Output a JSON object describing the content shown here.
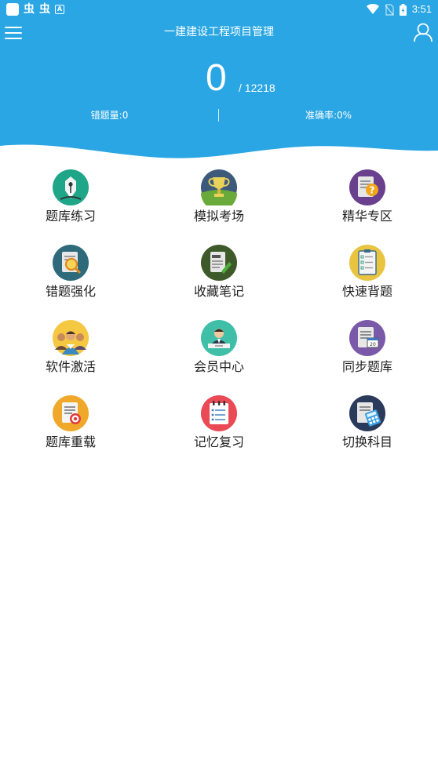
{
  "status_bar": {
    "left_glyph_1": "虫",
    "left_glyph_2": "虫",
    "left_badge": "A",
    "time": "3:51",
    "icons": [
      "wifi-icon",
      "no-sim-icon",
      "battery-charging-icon"
    ]
  },
  "header": {
    "title": "一建建设工程项目管理",
    "score": "0",
    "total": "/ 12218",
    "wrong_count": "错题量:0",
    "accuracy": "准确率:0%",
    "menu_icon": "menu-icon",
    "user_icon": "user-icon",
    "color": "#29a6e3"
  },
  "grid": {
    "items": [
      {
        "label": "题库练习",
        "icon": "pen-nib-icon"
      },
      {
        "label": "模拟考场",
        "icon": "trophy-icon"
      },
      {
        "label": "精华专区",
        "icon": "question-doc-icon"
      },
      {
        "label": "错题强化",
        "icon": "doc-magnifier-icon"
      },
      {
        "label": "收藏笔记",
        "icon": "notes-pen-icon"
      },
      {
        "label": "快速背题",
        "icon": "checklist-icon"
      },
      {
        "label": "软件激活",
        "icon": "people-group-icon"
      },
      {
        "label": "会员中心",
        "icon": "member-icon"
      },
      {
        "label": "同步题库",
        "icon": "calendar-doc-icon"
      },
      {
        "label": "题库重载",
        "icon": "doc-target-icon"
      },
      {
        "label": "记忆复习",
        "icon": "memory-list-icon"
      },
      {
        "label": "切换科目",
        "icon": "doc-calculator-icon"
      }
    ]
  }
}
